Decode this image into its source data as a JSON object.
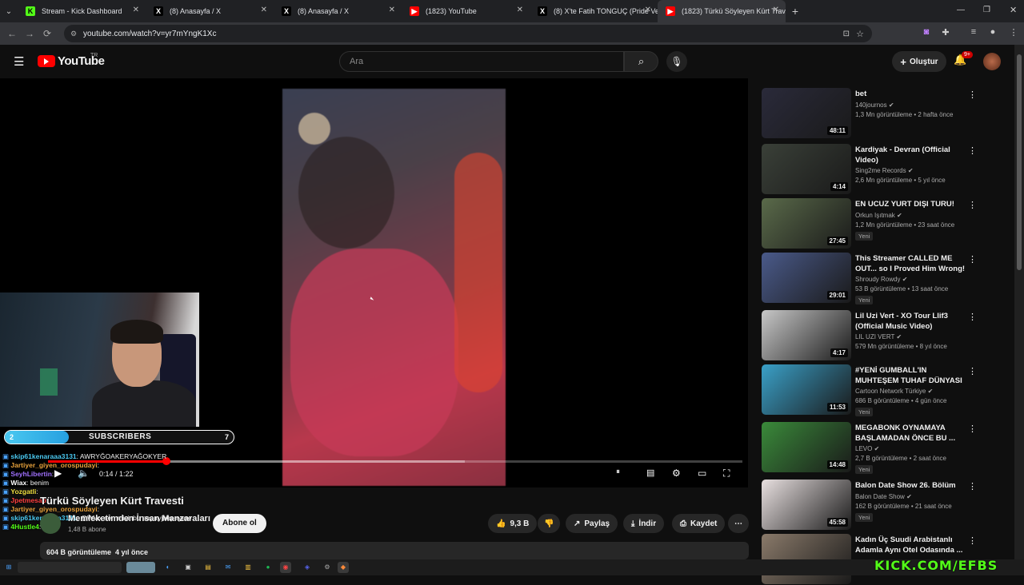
{
  "browser": {
    "tabs": [
      {
        "label": "Stream - Kick Dashboard",
        "fav": "K",
        "color": "#53fc18"
      },
      {
        "label": "(8) Anasayfa / X",
        "fav": "X",
        "color": "#000000"
      },
      {
        "label": "(8) Anasayfa / X",
        "fav": "X",
        "color": "#000000"
      },
      {
        "label": "(1823) YouTube",
        "fav": "▶",
        "color": "#ff0000"
      },
      {
        "label": "(8) X'te Fatih TONGUÇ (Pride Ve...",
        "fav": "X",
        "color": "#000000"
      },
      {
        "label": "(1823) Türkü Söyleyen Kürt Trave...",
        "fav": "▶",
        "color": "#ff0000"
      }
    ],
    "url": "youtube.com/watch?v=yr7mYngK1Xc"
  },
  "youtube": {
    "logo_text": "YouTube",
    "region": "TR",
    "search_placeholder": "Ara",
    "create_label": "Oluştur",
    "notif_count": "9+"
  },
  "player": {
    "time": "0:14 / 1:22",
    "progress": 0.17,
    "buffered": 0.6
  },
  "stream_overlay": {
    "sub_start": "2",
    "sub_label": "SUBSCRIBERS",
    "sub_goal": "7",
    "sub_fraction": 0.28,
    "chat": [
      {
        "user": "skip61kenaraaa3131",
        "msg": ": AWRYĞOAKERYAĞOKYER",
        "color": "#4ac8f0"
      },
      {
        "user": "Jartiyer_giyen_orospudayi",
        "msg": ":",
        "color": "#e8a23c"
      },
      {
        "user": "SeyhLibertin",
        "msg": ":",
        "color": "#a070ff"
      },
      {
        "user": "Wiax",
        "msg": ": benim",
        "color": "#ffffff"
      },
      {
        "user": "Yozgatli",
        "msg": ":",
        "color": "#f0e040"
      },
      {
        "user": "Jpetmesap",
        "msg": ":",
        "color": "#ff4040"
      },
      {
        "user": "Jartiyer_giyen_orospudayi",
        "msg": ":",
        "color": "#e8a23c"
      },
      {
        "user": "skip61kenaraaa3131",
        "msg": ": @Wiax sen misinbu aepıryjaepıryare",
        "color": "#4ac8f0"
      },
      {
        "user": "4Hustle4",
        "msg": ":",
        "color": "#53fc18"
      }
    ]
  },
  "video": {
    "title": "Türkü Söyleyen Kürt Travesti",
    "channel": "Memleketimden İnsan Manzaraları",
    "channel_subs": "1,48 B abone",
    "subscribe_label": "Abone ol",
    "likes": "9,3 B",
    "share_label": "Paylaş",
    "download_label": "İndir",
    "save_label": "Kaydet",
    "views": "604 B görüntüleme",
    "age": "4 yıl önce"
  },
  "recommendations": [
    {
      "title": "bet",
      "channel": "140journos",
      "meta": "1,3 Mn görüntüleme • 2 hafta önce",
      "duration": "48:11",
      "new": false,
      "bg": "#2a2a3a"
    },
    {
      "title": "Kardiyak - Devran (Official Video)",
      "channel": "Sing2me Records",
      "meta": "2,6 Mn görüntüleme • 5 yıl önce",
      "duration": "4:14",
      "new": false,
      "bg": "#3a4038"
    },
    {
      "title": "EN UCUZ YURT DIŞI TURU!",
      "channel": "Orkun Işıtmak",
      "meta": "1,2 Mn görüntüleme • 23 saat önce",
      "duration": "27:45",
      "new": true,
      "bg": "#5a6a4a"
    },
    {
      "title": "This Streamer CALLED ME OUT... so I Proved Him Wrong!",
      "channel": "Shroudy Rowdy",
      "meta": "53 B görüntüleme • 13 saat önce",
      "duration": "29:01",
      "new": true,
      "bg": "#4a5a8a"
    },
    {
      "title": "Lil Uzi Vert - XO Tour Llif3 (Official Music Video)",
      "channel": "LIL UZI VERT",
      "meta": "579 Mn görüntüleme • 8 yıl önce",
      "duration": "4:17",
      "new": false,
      "bg": "#c8c8c8"
    },
    {
      "title": "#YENİ GUMBALL'IN MUHTEŞEM TUHAF DÜNYASI |...",
      "channel": "Cartoon Network Türkiye",
      "meta": "686 B görüntüleme • 4 gün önce",
      "duration": "11:53",
      "new": true,
      "bg": "#3aa0c8"
    },
    {
      "title": "MEGABONK OYNAMAYA BAŞLAMADAN ÖNCE BU ...",
      "channel": "LEVO",
      "meta": "2,7 B görüntüleme • 2 saat önce",
      "duration": "14:48",
      "new": true,
      "bg": "#3a8a3a"
    },
    {
      "title": "Balon Date Show 26. Bölüm",
      "channel": "Balon Date Show",
      "meta": "162 B görüntüleme • 21 saat önce",
      "duration": "45:58",
      "new": true,
      "bg": "#e8e0e0"
    },
    {
      "title": "Kadın Üç Suudi Arabistanlı Adamla Aynı Otel Odasında ...",
      "channel": "",
      "meta": "",
      "duration": "",
      "new": false,
      "bg": "#8a7a6a"
    }
  ],
  "labels": {
    "new_badge": "Yeni"
  },
  "watermark": "KICK.COM/EFBS"
}
